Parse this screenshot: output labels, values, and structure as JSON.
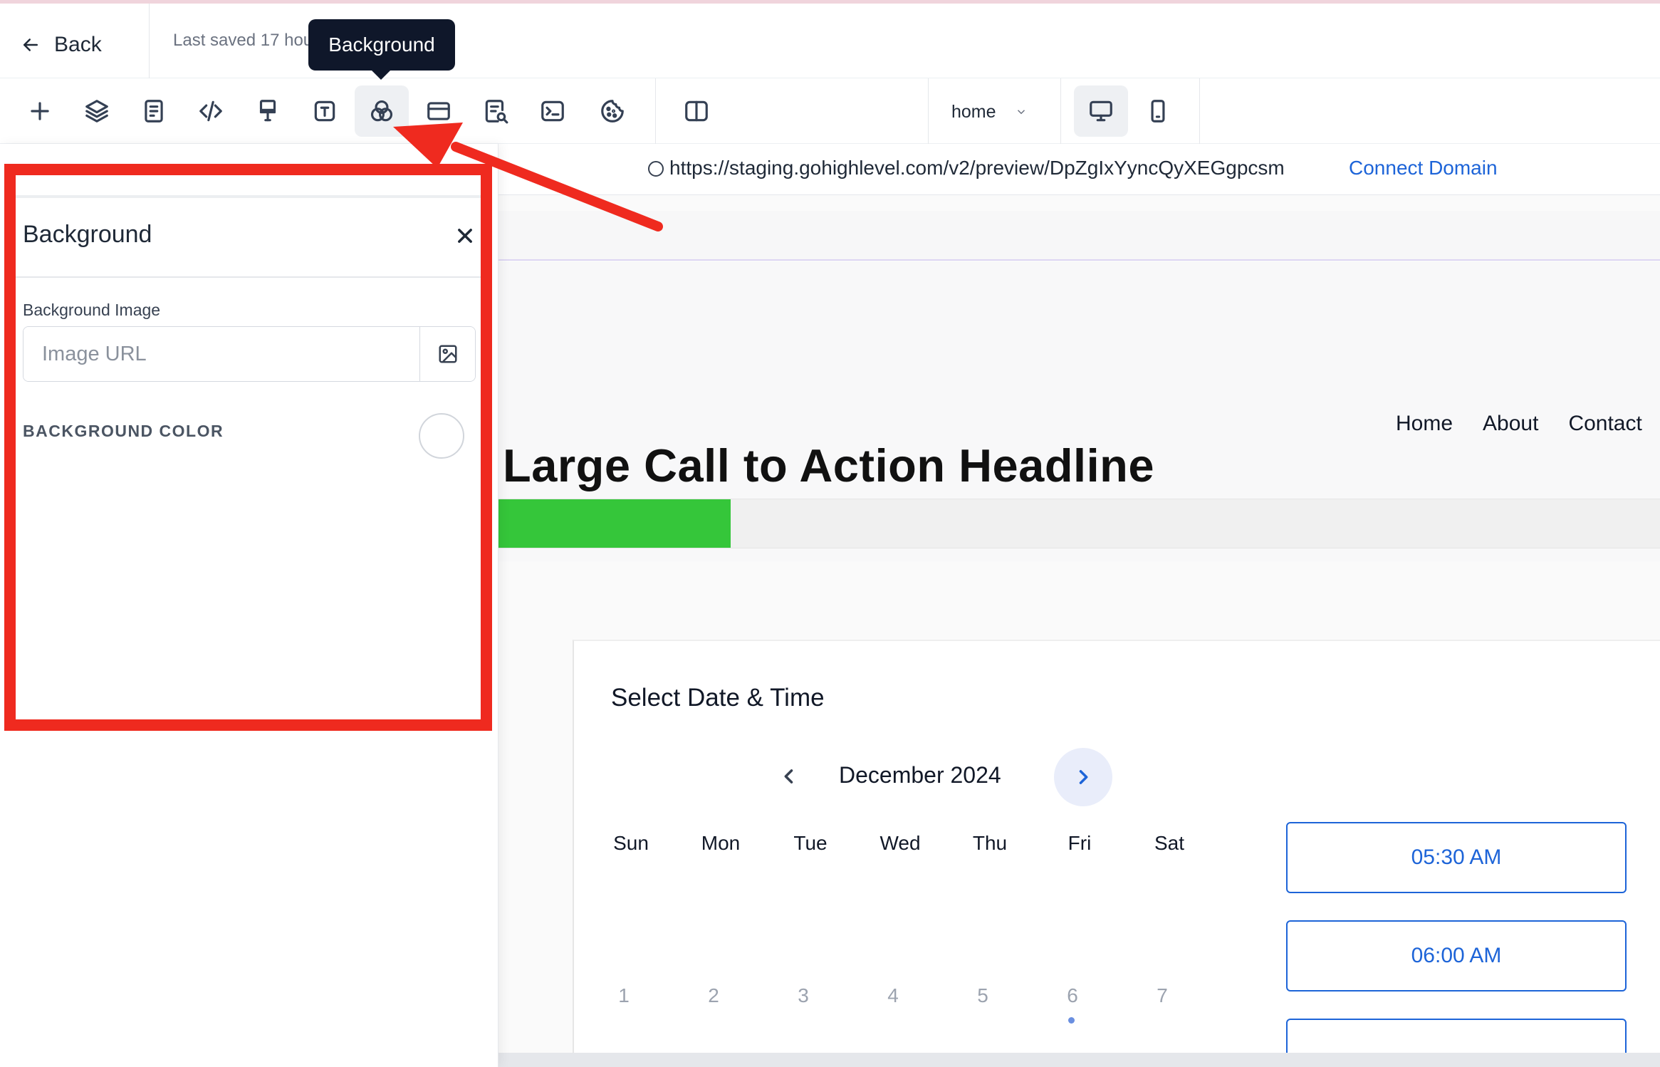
{
  "header": {
    "back_label": "Back",
    "last_saved": "Last saved 17 hours ago",
    "tooltip": "Background"
  },
  "toolbar": {
    "icons": [
      "plus-icon",
      "layers-icon",
      "pages-icon",
      "code-icon",
      "paint-brush-icon",
      "text-icon",
      "background-icon",
      "section-icon",
      "page-seo-icon",
      "terminal-icon",
      "cookie-icon",
      "split-view-icon"
    ],
    "page_selector": "home",
    "devices": [
      "desktop-icon",
      "mobile-icon"
    ]
  },
  "urlbar": {
    "url": "https://staging.gohighlevel.com/v2/preview/DpZgIxYyncQyXEGgpcsm",
    "connect_label": "Connect Domain"
  },
  "panel": {
    "title": "Background",
    "bg_image_label": "Background Image",
    "image_url_placeholder": "Image URL",
    "image_url_value": "",
    "bg_color_label": "BACKGROUND COLOR"
  },
  "preview": {
    "nav": [
      "Home",
      "About",
      "Contact"
    ],
    "headline": "Large Call to Action Headline",
    "progress_fraction": 0.2,
    "calendar": {
      "title": "Select Date & Time",
      "month": "December 2024",
      "days": [
        "Sun",
        "Mon",
        "Tue",
        "Wed",
        "Thu",
        "Fri",
        "Sat"
      ],
      "dates": [
        "1",
        "2",
        "3",
        "4",
        "5",
        "6",
        "7"
      ],
      "slots": [
        "05:30 AM",
        "06:00 AM"
      ]
    }
  },
  "colors": {
    "accent": "#1d64d8",
    "highlight": "#ef2a1f",
    "progress": "#35c63a"
  }
}
